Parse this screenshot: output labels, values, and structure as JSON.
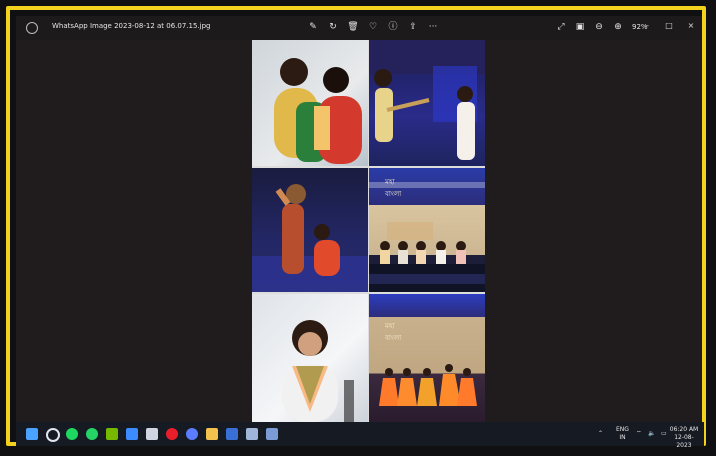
{
  "window": {
    "title": "WhatsApp Image 2023-08-12 at 06.07.15.jpg",
    "zoom": "92%"
  },
  "toolbar": {
    "items": [
      {
        "name": "edit-icon",
        "glyph": "✎"
      },
      {
        "name": "rotate-icon",
        "glyph": "↻"
      },
      {
        "name": "delete-icon",
        "glyph": "🗑"
      },
      {
        "name": "favorite-icon",
        "glyph": "♡"
      },
      {
        "name": "info-icon",
        "glyph": "ⓘ"
      },
      {
        "name": "share-icon",
        "glyph": "⇪"
      },
      {
        "name": "more-icon",
        "glyph": "···"
      }
    ],
    "right": [
      {
        "name": "fullscreen-icon",
        "glyph": "⤢"
      },
      {
        "name": "fit-icon",
        "glyph": "▣"
      },
      {
        "name": "zoom-out-icon",
        "glyph": "⊖"
      },
      {
        "name": "zoom-in-icon",
        "glyph": "⊕"
      }
    ]
  },
  "taskbar": {
    "lang_line1": "ENG",
    "lang_line2": "IN",
    "time": "06:20 AM",
    "date": "12-08-2023",
    "icons": [
      {
        "name": "windows-start-icon",
        "color": "#4aa3ff"
      },
      {
        "name": "search-icon",
        "color": "#dfe6f0"
      },
      {
        "name": "spotify-icon",
        "color": "#1ed760"
      },
      {
        "name": "whatsapp-icon",
        "color": "#25d366"
      },
      {
        "name": "nvidia-icon",
        "color": "#76b900"
      },
      {
        "name": "todo-icon",
        "color": "#3c8cff"
      },
      {
        "name": "notes-icon",
        "color": "#cfd6e2"
      },
      {
        "name": "opera-icon",
        "color": "#e81f2a"
      },
      {
        "name": "chrome-icon",
        "color": "#5b7cff"
      },
      {
        "name": "file-explorer-icon",
        "color": "#f2c14e"
      },
      {
        "name": "word-icon",
        "color": "#3b6fd8"
      },
      {
        "name": "photos-icon",
        "color": "#9fb6d9"
      },
      {
        "name": "app-icon",
        "color": "#7a9bd6"
      }
    ]
  }
}
